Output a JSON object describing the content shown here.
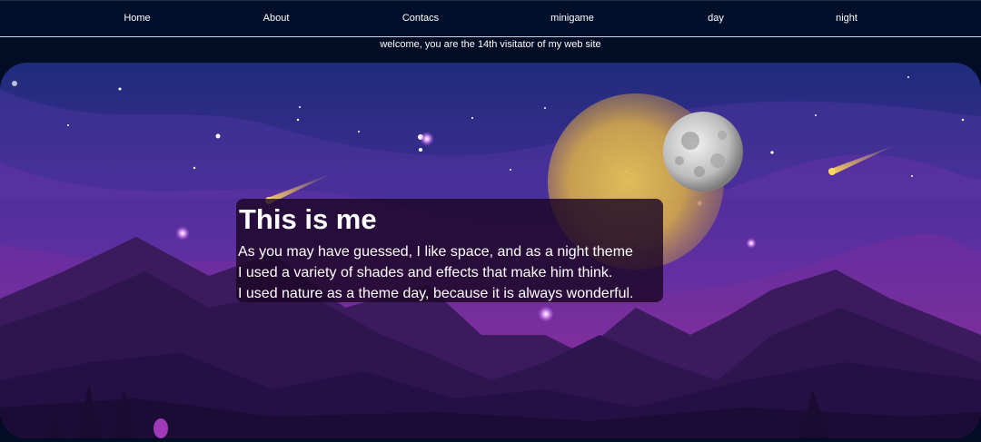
{
  "nav": {
    "items": [
      {
        "label": "Home"
      },
      {
        "label": "About"
      },
      {
        "label": "Contacs"
      },
      {
        "label": "minigame"
      },
      {
        "label": "day"
      },
      {
        "label": "night"
      }
    ]
  },
  "welcome": {
    "text": "welcome, you are the 14th visitator of my web site"
  },
  "hero": {
    "title": "This is me",
    "lines": [
      "As you may have guessed, I like space, and as a night theme",
      "I used a variety of shades and effects that make him think.",
      "I used nature as a theme day, because it is always wonderful."
    ]
  },
  "colors": {
    "navbar_bg": "#00102b",
    "sky_top": "#1e2a78",
    "sky_mid": "#5a2a9a",
    "mountain_dark": "#2a1548",
    "planet_yellow": "#e8c34a",
    "textbox_bg": "#1c0624"
  },
  "icons": [
    "moon-icon",
    "planet-icon",
    "shooting-star-icon",
    "tree-icon"
  ]
}
